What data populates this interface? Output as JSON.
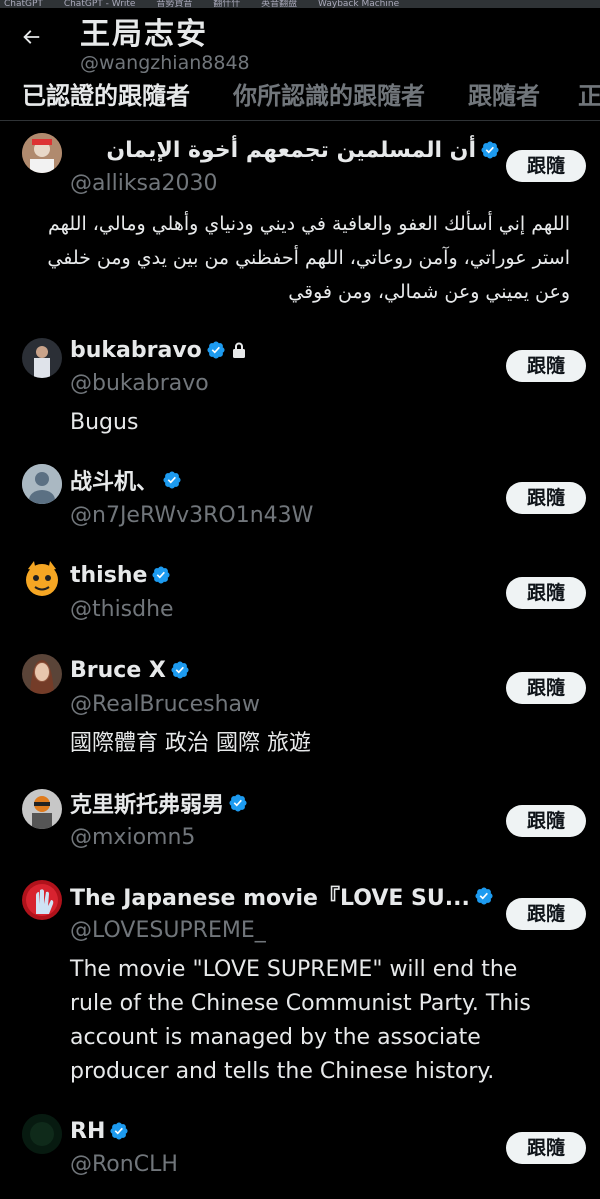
{
  "bookmarks": [
    "ChatGPT",
    "ChatGPT - Write",
    "音勢貨音",
    "翻什什",
    "英音翻盘",
    "Wayback Machine"
  ],
  "header": {
    "title": "王局志安",
    "handle": "@wangzhian8848"
  },
  "tabs": [
    {
      "label": "已認證的跟隨者",
      "active": true
    },
    {
      "label": "你所認識的跟隨者",
      "active": false
    },
    {
      "label": "跟隨者",
      "active": false
    },
    {
      "label": "正",
      "active": false
    }
  ],
  "follow_label": "跟隨",
  "accent_color": "#1d9bf0",
  "users": [
    {
      "name": "أن المسلمين تجمعهم أخوة الإيمان",
      "handle": "@alliksa2030",
      "verified": true,
      "bio": "اللهم إني أسألك العفو والعافية في ديني ودنياي وأهلي ومالي، اللهم استر عوراتي، وآمن روعاتي، اللهم أحفظني من بين يدي ومن خلفي وعن يميني وعن شمالي، ومن فوقي"
    },
    {
      "name": "bukabravo",
      "handle": "@bukabravo",
      "verified": true,
      "locked": true,
      "bio": "Bugus"
    },
    {
      "name": "战斗机、",
      "handle": "@n7JeRWv3RO1n43W",
      "verified": true,
      "bio": ""
    },
    {
      "name": "thishe",
      "handle": "@thisdhe",
      "verified": true,
      "bio": ""
    },
    {
      "name": "Bruce X",
      "handle": "@RealBruceshaw",
      "verified": true,
      "bio": "國際體育 政治 國際 旅遊"
    },
    {
      "name": "克里斯托弗弱男",
      "handle": "@mxiomn5",
      "verified": true,
      "bio": ""
    },
    {
      "name": "The Japanese movie『LOVE SU...",
      "handle": "@LOVESUPREME_",
      "verified": true,
      "bio": "The movie \"LOVE SUPREME\" will end the rule of the Chinese Communist Party. This account is managed by the associate producer and tells the Chinese history."
    },
    {
      "name": "RH",
      "handle": "@RonCLH",
      "verified": true,
      "bio": ""
    }
  ]
}
